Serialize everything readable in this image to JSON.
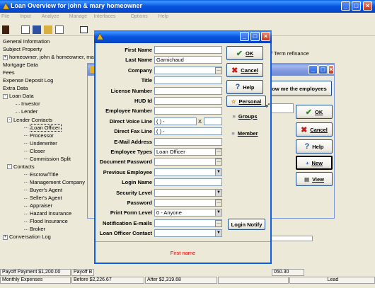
{
  "main_window": {
    "title": "Loan Overview for john & mary homeowner",
    "menu": [
      "File",
      "Input",
      "Analyze",
      "Manage",
      "Interfaces",
      "Options",
      "Help"
    ],
    "refinance_text": "/ Term refinance"
  },
  "tree": [
    {
      "label": "General Information",
      "indent": 0,
      "expander": ""
    },
    {
      "label": "Subject Property",
      "indent": 0,
      "expander": ""
    },
    {
      "label": "homeowner, john & homeowner, mary",
      "indent": 0,
      "expander": "+"
    },
    {
      "label": "Mortgage Data",
      "indent": 0,
      "expander": ""
    },
    {
      "label": "Fees",
      "indent": 0,
      "expander": ""
    },
    {
      "label": "Expense Deposit Log",
      "indent": 0,
      "expander": ""
    },
    {
      "label": "Extra Data",
      "indent": 0,
      "expander": ""
    },
    {
      "label": "Loan Data",
      "indent": 0,
      "expander": "-"
    },
    {
      "label": "Investor",
      "indent": 2,
      "expander": ""
    },
    {
      "label": "Lender",
      "indent": 2,
      "expander": ""
    },
    {
      "label": "Lender Contacts",
      "indent": 1,
      "expander": "-"
    },
    {
      "label": "Loan Officer",
      "indent": 3,
      "expander": "",
      "selected": true
    },
    {
      "label": "Processor",
      "indent": 3,
      "expander": ""
    },
    {
      "label": "Underwriter",
      "indent": 3,
      "expander": ""
    },
    {
      "label": "Closer",
      "indent": 3,
      "expander": ""
    },
    {
      "label": "Commission Split",
      "indent": 3,
      "expander": ""
    },
    {
      "label": "Contacts",
      "indent": 1,
      "expander": "-"
    },
    {
      "label": "Escrow/Title",
      "indent": 3,
      "expander": ""
    },
    {
      "label": "Management Company",
      "indent": 3,
      "expander": ""
    },
    {
      "label": "Buyer's Agent",
      "indent": 3,
      "expander": ""
    },
    {
      "label": "Seller's Agent",
      "indent": 3,
      "expander": ""
    },
    {
      "label": "Appraiser",
      "indent": 3,
      "expander": ""
    },
    {
      "label": "Hazard Insurance",
      "indent": 3,
      "expander": ""
    },
    {
      "label": "Flood Insurance",
      "indent": 3,
      "expander": ""
    },
    {
      "label": "Broker",
      "indent": 3,
      "expander": ""
    },
    {
      "label": "Conversation Log",
      "indent": 0,
      "expander": "+"
    }
  ],
  "middle_dialog": {
    "show_employees_label": "ow me the employees",
    "ok_label": "OK",
    "cancel_label": "Cancel",
    "help_label": "Help",
    "new_label": "New",
    "view_label": "View"
  },
  "form_dialog": {
    "fields": [
      {
        "label": "First Name",
        "value": "",
        "kind": "text"
      },
      {
        "label": "Last Name",
        "value": "Garnichaud",
        "kind": "text"
      },
      {
        "label": "Company",
        "value": "",
        "kind": "ellipsis"
      },
      {
        "label": "Title",
        "value": "",
        "kind": "text"
      },
      {
        "label": "License Number",
        "value": "",
        "kind": "text"
      },
      {
        "label": "HUD Id",
        "value": "",
        "kind": "text"
      },
      {
        "label": "Employee Number",
        "value": "",
        "kind": "text"
      },
      {
        "label": "Direct Voice Line",
        "value": "(   )    -",
        "kind": "phone",
        "ext": "X"
      },
      {
        "label": "Direct Fax Line",
        "value": "(   )    -",
        "kind": "text"
      },
      {
        "label": "E-Mail Address",
        "value": "",
        "kind": "text"
      },
      {
        "label": "Employee Types",
        "value": "Loan Officer",
        "kind": "ellipsis"
      },
      {
        "label": "Document Password",
        "value": "",
        "kind": "ellipsis"
      },
      {
        "label": "Previous Employee",
        "value": "",
        "kind": "dropdown"
      },
      {
        "label": "Login Name",
        "value": "",
        "kind": "text"
      },
      {
        "label": "Security Level",
        "value": "",
        "kind": "dropdown"
      },
      {
        "label": "Password",
        "value": "",
        "kind": "ellipsis"
      },
      {
        "label": "Print Form Level",
        "value": "0 - Anyone",
        "kind": "dropdown"
      },
      {
        "label": "Notification E-mails",
        "value": "",
        "kind": "ellipsis"
      },
      {
        "label": "Loan Officer Contact",
        "value": "",
        "kind": "dropdown"
      }
    ],
    "buttons": {
      "ok": "OK",
      "cancel": "Cancel",
      "help": "Help",
      "personal": "Personal",
      "groups": "Groups",
      "member": "Member",
      "login_notify": "Login Notify"
    },
    "status_message": "First name",
    "status_color": "#E00000"
  },
  "status_bar": {
    "row1": [
      "Payoff Payment $1,200.00",
      "Payoff B",
      "",
      "",
      "050.30"
    ],
    "row2": [
      "Monthly Expenses",
      "Before $2,226.67",
      "After $2,319.68",
      "",
      "Lead"
    ]
  },
  "colors": {
    "xp_blue": "#0A5EE8",
    "ok_green": "#2E8B2E",
    "cancel_red": "#C02020",
    "help_blue": "#1A55B8"
  }
}
